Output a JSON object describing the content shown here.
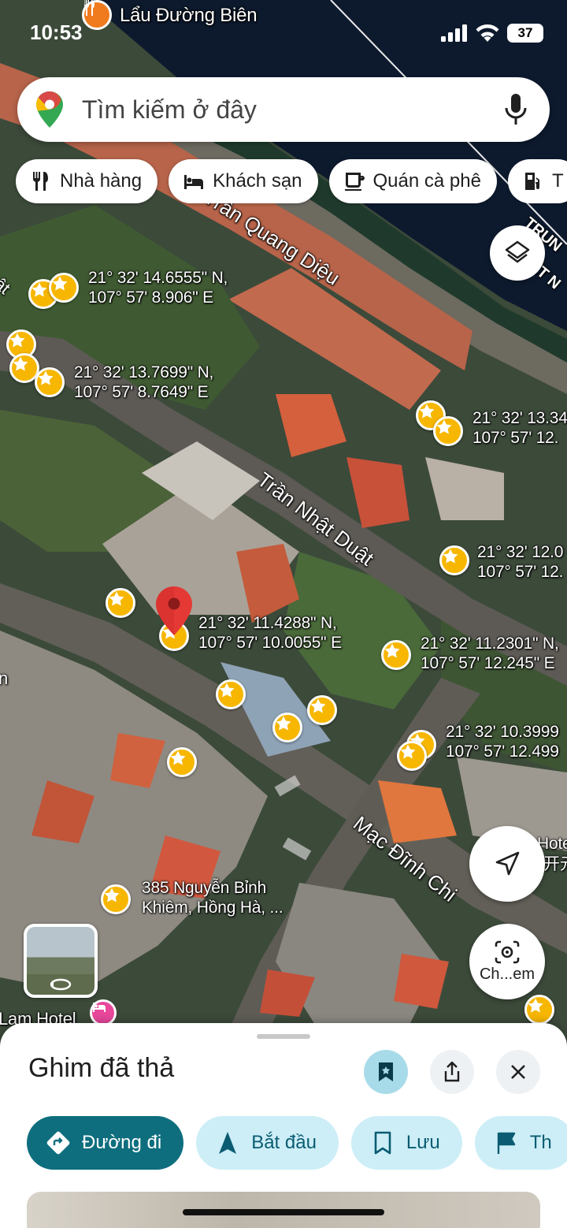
{
  "status": {
    "time": "10:53",
    "battery": "37"
  },
  "map": {
    "poi_top": "Lẩu Đường Biên",
    "streets": [
      "Trần Quang Diệu",
      "Trần Nhật Duật",
      "Mạc Đĩnh Chi"
    ],
    "coordinate_labels": [
      [
        "21° 32' 14.6555\" N,",
        "107° 57' 8.906\" E"
      ],
      [
        "21° 32' 13.7699\" N,",
        "107° 57' 8.7649\" E"
      ],
      [
        "21° 32' 13.34",
        "107° 57' 12."
      ],
      [
        "21° 32' 12.0",
        "107° 57' 12."
      ],
      [
        "21° 32' 11.4288\" N,",
        "107° 57' 10.0055\" E"
      ],
      [
        "21° 32' 11.2301\" N,",
        "107° 57' 12.245\" E"
      ],
      [
        "21° 32' 10.3999",
        "107° 57' 12.499"
      ],
      [
        "385 Nguyễn Bỉnh",
        "Khiêm, Hồng Hà, ..."
      ]
    ],
    "edge_labels": {
      "left_top": "ật",
      "left_mid": "n",
      "hotel_left": "Lam Hotel",
      "right_hotel": "Hotel",
      "right_hotel_2": "开元",
      "right_corner": "TRUN",
      "right_corner_2": "ỆT N"
    }
  },
  "search": {
    "placeholder": "Tìm kiếm ở đây",
    "logo_icon": "google-maps-pin-icon",
    "mic_icon": "mic-icon"
  },
  "chips": [
    {
      "label": "Nhà hàng",
      "icon": "restaurant-icon"
    },
    {
      "label": "Khách sạn",
      "icon": "hotel-icon"
    },
    {
      "label": "Quán cà phê",
      "icon": "coffee-icon"
    },
    {
      "label": "T",
      "icon": "gas-station-icon"
    }
  ],
  "buttons": {
    "camera_label": "Ch...em"
  },
  "sheet": {
    "title": "Ghim đã thả",
    "actions": [
      {
        "label": "Đường đi",
        "icon": "directions-icon"
      },
      {
        "label": "Bắt đầu",
        "icon": "navigation-icon"
      },
      {
        "label": "Lưu",
        "icon": "bookmark-icon"
      },
      {
        "label": "Th",
        "icon": "flag-icon"
      }
    ]
  },
  "colors": {
    "accent": "#0e6e7e",
    "chip_action_bg": "#cdeef7",
    "star": "#f7b600",
    "pin": "#e53935"
  }
}
